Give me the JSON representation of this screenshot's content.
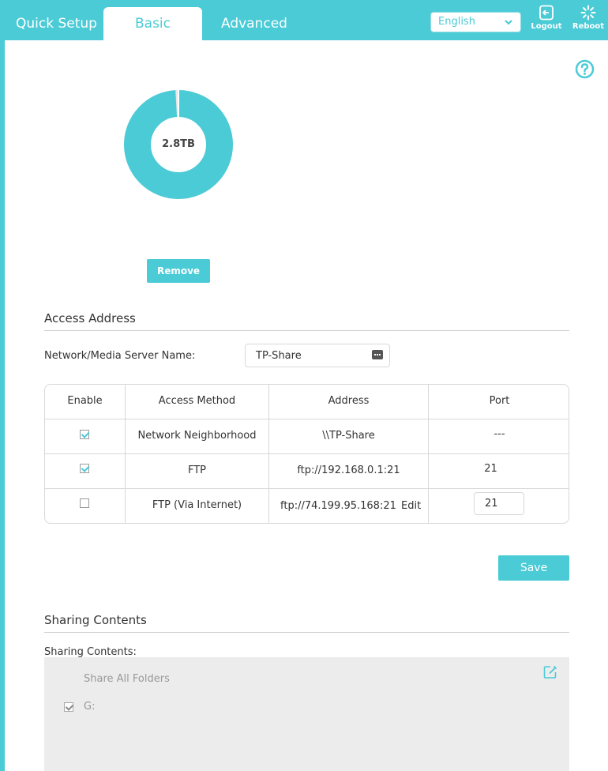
{
  "nav": {
    "tabs": [
      "Quick Setup",
      "Basic",
      "Advanced"
    ],
    "active_tab": "Basic",
    "language": "English",
    "logout_label": "Logout",
    "reboot_label": "Reboot"
  },
  "storage": {
    "capacity_label": "2.8TB",
    "used_fraction": 0.99,
    "remove_label": "Remove"
  },
  "access_address": {
    "title": "Access Address",
    "server_name_label": "Network/Media Server Name:",
    "server_name_value": "TP-Share",
    "table": {
      "headers": [
        "Enable",
        "Access Method",
        "Address",
        "Port"
      ],
      "rows": [
        {
          "enabled": true,
          "method": "Network Neighborhood",
          "address": "\\\\TP-Share",
          "port": "---"
        },
        {
          "enabled": true,
          "method": "FTP",
          "address": "ftp://192.168.0.1:21",
          "port": "21"
        },
        {
          "enabled": false,
          "method": "FTP (Via Internet)",
          "address": "ftp://74.199.95.168:21",
          "edit_label": "Edit",
          "port": "21"
        }
      ]
    },
    "save_label": "Save"
  },
  "sharing": {
    "title": "Sharing Contents",
    "label": "Sharing Contents:",
    "share_all_label": "Share All Folders",
    "volumes": [
      {
        "name": "G:",
        "checked": true
      }
    ]
  },
  "colors": {
    "accent": "#4acbd6",
    "border": "#d8d8d8",
    "share_bg": "#ececec"
  }
}
